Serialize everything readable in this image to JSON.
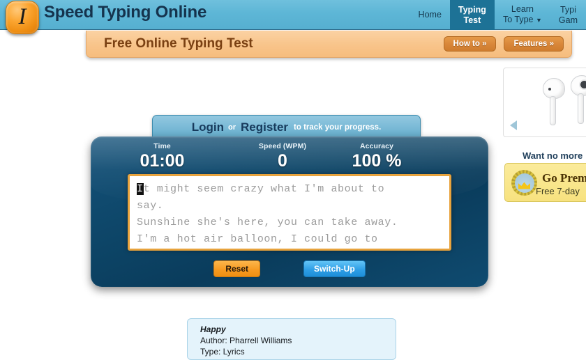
{
  "header": {
    "site_title": "Speed Typing Online",
    "logo_glyph": "I",
    "nav": [
      {
        "line1": "Home",
        "line2": "",
        "active": false,
        "caret": ""
      },
      {
        "line1": "Typing",
        "line2": "Test",
        "active": true,
        "caret": ""
      },
      {
        "line1": "Learn",
        "line2": "To Type",
        "active": false,
        "caret": "▼"
      },
      {
        "line1": "Typi",
        "line2": "Gam",
        "active": false,
        "caret": ""
      }
    ]
  },
  "banner": {
    "title": "Free Online Typing Test",
    "how_to_label": "How to »",
    "features_label": "Features »"
  },
  "ad": {
    "carousel_prev_label": "◀"
  },
  "promo": {
    "headline": "Want no more",
    "title": "Go Prem",
    "subtitle": "Free 7-day"
  },
  "login_strip": {
    "login_label": "Login",
    "or_label": "or",
    "register_label": "Register",
    "tail_text": "to track your progress."
  },
  "test_panel": {
    "stats": {
      "time_label": "Time",
      "time_value": "01:00",
      "speed_label": "Speed (WPM)",
      "speed_value": "0",
      "accuracy_label": "Accuracy",
      "accuracy_value": "100 %"
    },
    "passage": {
      "cursor_char": "I",
      "line1_rest": "t might seem crazy what I'm about to",
      "line2": "say.",
      "line3": "Sunshine she's here, you can take away.",
      "line4": "I'm a hot air balloon, I could go to"
    },
    "reset_label": "Reset",
    "switch_label": "Switch-Up"
  },
  "song_info": {
    "title": "Happy",
    "author": "Author: Pharrell Williams",
    "type": "Type: Lyrics"
  },
  "colors": {
    "header_blue": "#5db6d6",
    "nav_active": "#1d7296",
    "banner_peach": "#f8c48a",
    "panel_navy": "#0d4567",
    "textbox_border": "#e8a33d",
    "reset_orange": "#f79b22",
    "switch_blue": "#2f9fe6",
    "promo_yellow": "#f7e27f"
  }
}
